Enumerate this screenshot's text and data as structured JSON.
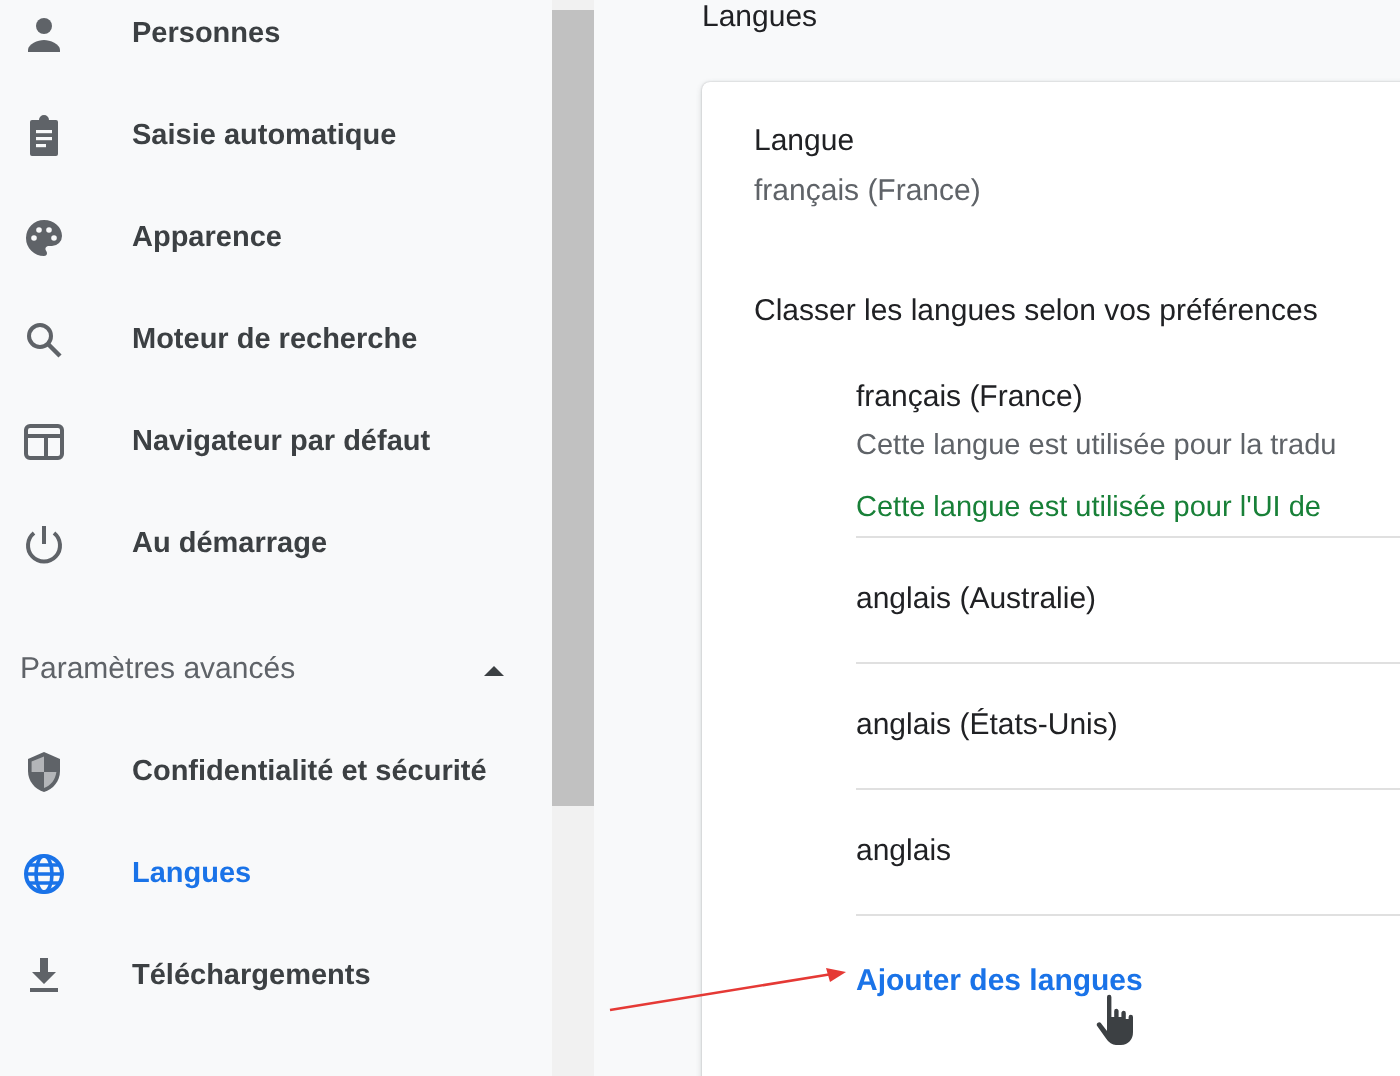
{
  "sidebar": {
    "items": [
      {
        "label": "Personnes",
        "selected": false
      },
      {
        "label": "Saisie automatique",
        "selected": false
      },
      {
        "label": "Apparence",
        "selected": false
      },
      {
        "label": "Moteur de recherche",
        "selected": false
      },
      {
        "label": "Navigateur par défaut",
        "selected": false
      },
      {
        "label": "Au démarrage",
        "selected": false
      }
    ],
    "advanced": {
      "label": "Paramètres avancés",
      "expanded": true
    },
    "advanced_items": [
      {
        "label": "Confidentialité et sécurité",
        "selected": false
      },
      {
        "label": "Langues",
        "selected": true
      },
      {
        "label": "Téléchargements",
        "selected": false
      }
    ]
  },
  "page_title": "Langues",
  "language_card": {
    "label": "Langue",
    "value": "français (France)",
    "order_heading": "Classer les langues selon vos préférences",
    "languages": [
      {
        "name": "français (France)",
        "notes": [
          {
            "kind": "plain",
            "text": "Cette langue est utilisée pour la tradu"
          },
          {
            "kind": "active",
            "text": "Cette langue est utilisée pour l'UI de"
          }
        ]
      },
      {
        "name": "anglais (Australie)"
      },
      {
        "name": "anglais (États-Unis)"
      },
      {
        "name": "anglais"
      }
    ],
    "add_link": "Ajouter des langues"
  }
}
